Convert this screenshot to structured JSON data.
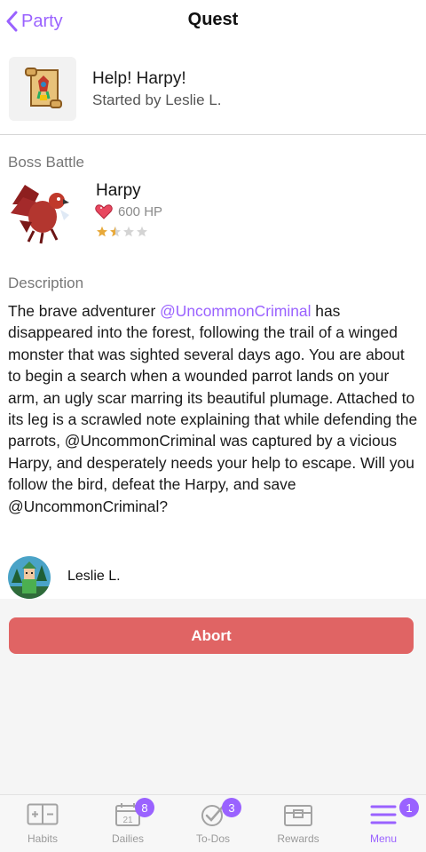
{
  "nav": {
    "back_label": "Party",
    "title": "Quest"
  },
  "quest": {
    "title": "Help! Harpy!",
    "started_by": "Started by Leslie L."
  },
  "boss": {
    "section_label": "Boss Battle",
    "name": "Harpy",
    "hp": "600 HP",
    "difficulty_stars": 1.5,
    "max_stars": 4
  },
  "description": {
    "section_label": "Description",
    "text_1": "The brave adventurer ",
    "mention": "@UncommonCriminal",
    "text_2": " has disappeared into the forest, following the trail of a winged monster that was sighted several days ago. You are about to begin a search when a wounded parrot lands on your arm, an ugly scar marring its beautiful plumage. Attached to its leg is a scrawled note explaining that while defending the parrots, @UncommonCriminal was captured by a vicious Harpy, and desperately needs your help to escape. Will you follow the bird, defeat the Harpy, and save @UncommonCriminal?"
  },
  "member": {
    "name": "Leslie L."
  },
  "abort_label": "Abort",
  "tabs": [
    {
      "label": "Habits",
      "icon": "habits-icon",
      "badge": ""
    },
    {
      "label": "Dailies",
      "icon": "calendar-icon",
      "badge": "8",
      "calendar_day": "21"
    },
    {
      "label": "To-Dos",
      "icon": "check-circle-icon",
      "badge": "3"
    },
    {
      "label": "Rewards",
      "icon": "treasure-chest-icon",
      "badge": ""
    },
    {
      "label": "Menu",
      "icon": "menu-icon",
      "badge": "1"
    }
  ],
  "colors": {
    "accent": "#9a62ff",
    "abort": "#e06464",
    "inactive": "#9a9a9a"
  }
}
